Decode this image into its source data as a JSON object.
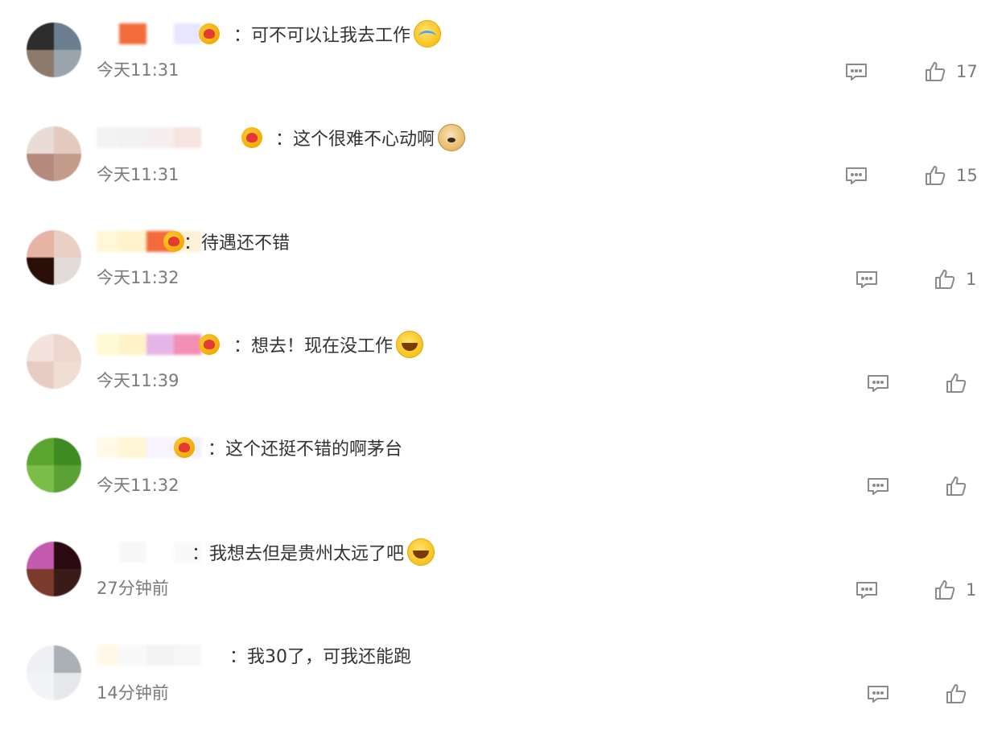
{
  "comments": [
    {
      "text": "：可不可以让我去工作",
      "time": "今天11:31",
      "likes": "17",
      "emoji": "cry-emoji",
      "avatar": [
        "#2d2d2d",
        "#6b7e90",
        "#8c7a6c",
        "#9aa4ad"
      ],
      "name_colors": [
        "#ffffff",
        "#f26b3a",
        "#ffffff",
        "#e8e6ff"
      ]
    },
    {
      "text": "：这个很难不心动啊",
      "time": "今天11:31",
      "likes": "15",
      "emoji": "doge-emoji",
      "avatar": [
        "#e9dcd6",
        "#e4c9bf",
        "#b58a7c",
        "#c49c8c"
      ],
      "name_colors": [
        "#f3f3f3",
        "#f2f2f2",
        "#f6eeee",
        "#f5e4e0"
      ]
    },
    {
      "text": "：待遇还不错",
      "time": "今天11:32",
      "likes": "1",
      "emoji": "",
      "avatar": [
        "#e7b3a2",
        "#e9cfc4",
        "#2a0f09",
        "#e2dcd8"
      ],
      "name_colors": [
        "#fff7d6",
        "#fff3cc",
        "#f26b3a",
        "#fff0d8"
      ]
    },
    {
      "text": "：想去！现在没工作",
      "time": "今天11:39",
      "likes": "",
      "emoji": "laugh-emoji",
      "avatar": [
        "#f3e3dc",
        "#ecd6cd",
        "#e6ccc2",
        "#f0ddd4"
      ],
      "name_colors": [
        "#fffad4",
        "#fff2c7",
        "#e6b5e8",
        "#f28fb5"
      ]
    },
    {
      "text": "：这个还挺不错的啊茅台",
      "time": "今天11:32",
      "likes": "",
      "emoji": "",
      "avatar": [
        "#5aa52e",
        "#3f8b22",
        "#7bbd49",
        "#5ba235"
      ],
      "name_colors": [
        "#fff9e6",
        "#fff6d6",
        "#f7f4ff",
        "#f2f0ff"
      ]
    },
    {
      "text": "：我想去但是贵州太远了吧",
      "time": "27分钟前",
      "likes": "1",
      "emoji": "laugh-emoji",
      "avatar": [
        "#c45bb0",
        "#2a0a10",
        "#7a3b2c",
        "#3b1a1a"
      ],
      "name_colors": [
        "#ffffff",
        "#f7f7f7",
        "#ffffff",
        "#f9f9f9"
      ]
    },
    {
      "text": "：我30了，可我还能跑",
      "time": "14分钟前",
      "likes": "",
      "emoji": "",
      "avatar": [
        "#eef0f4",
        "#aab0b6",
        "#f3f4f7",
        "#e6e8ec"
      ],
      "name_colors": [
        "#fff8e8",
        "#f9f9f9",
        "#f3f3f3",
        "#f6f6f6"
      ]
    }
  ]
}
